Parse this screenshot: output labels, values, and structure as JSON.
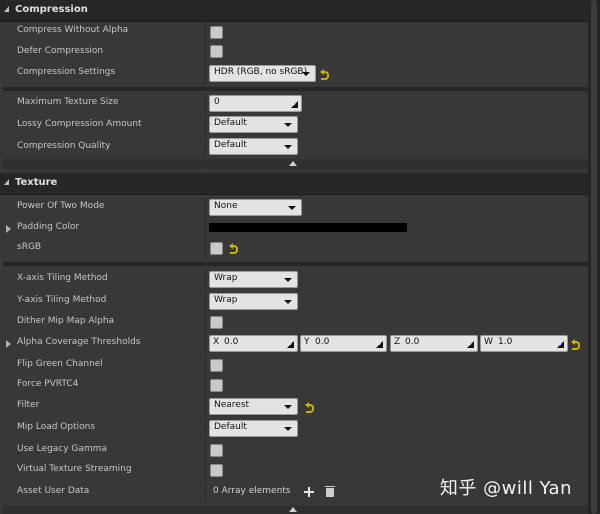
{
  "compression": {
    "title": "Compression",
    "compress_without_alpha": {
      "label": "Compress Without Alpha",
      "checked": false
    },
    "defer_compression": {
      "label": "Defer Compression",
      "checked": false
    },
    "compression_settings": {
      "label": "Compression Settings",
      "value": "HDR (RGB, no sRGB)"
    },
    "max_texture_size": {
      "label": "Maximum Texture Size",
      "value": "0"
    },
    "lossy_compression_amount": {
      "label": "Lossy Compression Amount",
      "value": "Default"
    },
    "compression_quality": {
      "label": "Compression Quality",
      "value": "Default"
    }
  },
  "texture": {
    "title": "Texture",
    "power_of_two_mode": {
      "label": "Power Of Two Mode",
      "value": "None"
    },
    "padding_color": {
      "label": "Padding Color",
      "color": "#000000"
    },
    "srgb": {
      "label": "sRGB",
      "checked": false
    },
    "x_tiling": {
      "label": "X-axis Tiling Method",
      "value": "Wrap"
    },
    "y_tiling": {
      "label": "Y-axis Tiling Method",
      "value": "Wrap"
    },
    "dither_mip_map_alpha": {
      "label": "Dither Mip Map Alpha",
      "checked": false
    },
    "alpha_coverage_thresholds": {
      "label": "Alpha Coverage Thresholds",
      "x_label": "X",
      "x": "0.0",
      "y_label": "Y",
      "y": "0.0",
      "z_label": "Z",
      "z": "0.0",
      "w_label": "W",
      "w": "1.0"
    },
    "flip_green_channel": {
      "label": "Flip Green Channel",
      "checked": false
    },
    "force_pvrtc4": {
      "label": "Force PVRTC4",
      "checked": false
    },
    "filter": {
      "label": "Filter",
      "value": "Nearest"
    },
    "mip_load_options": {
      "label": "Mip Load Options",
      "value": "Default"
    },
    "use_legacy_gamma": {
      "label": "Use Legacy Gamma",
      "checked": false
    },
    "virtual_texture_streaming": {
      "label": "Virtual Texture Streaming",
      "checked": false
    },
    "asset_user_data": {
      "label": "Asset User Data",
      "value": "0 Array elements"
    }
  },
  "icons": {
    "reset": "reset-to-default-icon",
    "add": "plus-icon",
    "delete": "trash-icon",
    "collapse": "collapse-up-icon"
  },
  "watermark": "知乎 @will Yan"
}
